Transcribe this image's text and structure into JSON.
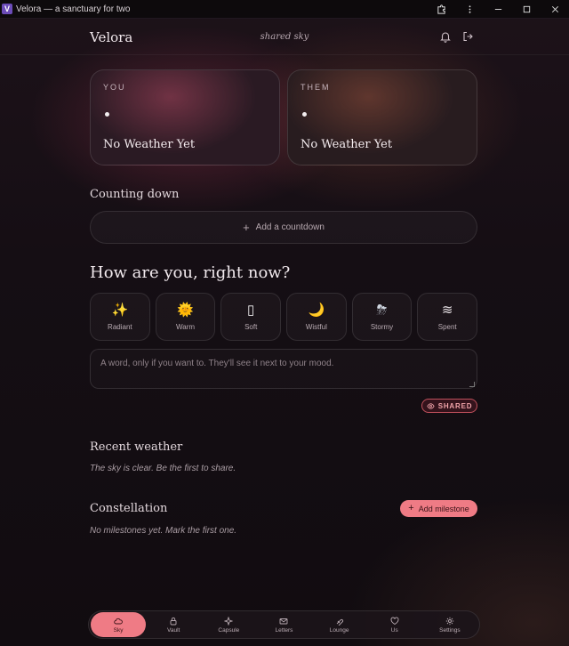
{
  "window": {
    "title": "Velora — a sanctuary for two",
    "app_icon_letter": "V"
  },
  "header": {
    "brand": "Velora",
    "subtitle": "shared sky"
  },
  "weather_cards": [
    {
      "label": "YOU",
      "status": "No Weather Yet"
    },
    {
      "label": "THEM",
      "status": "No Weather Yet"
    }
  ],
  "countdown": {
    "title": "Counting down",
    "add_label": "Add a countdown"
  },
  "mood": {
    "title": "How are you, right now?",
    "options": [
      {
        "emoji": "✨",
        "label": "Radiant"
      },
      {
        "emoji": "🌞",
        "label": "Warm"
      },
      {
        "emoji": "▯",
        "label": "Soft"
      },
      {
        "emoji": "🌙",
        "label": "Wistful"
      },
      {
        "emoji": "⛈",
        "label": "Stormy"
      },
      {
        "emoji": "≋",
        "label": "Spent"
      }
    ],
    "note_placeholder": "A word, only if you want to. They'll see it next to your mood.",
    "note_value": "",
    "visibility_label": "SHARED"
  },
  "recent_weather": {
    "title": "Recent weather",
    "empty_text": "The sky is clear. Be the first to share."
  },
  "constellation": {
    "title": "Constellation",
    "add_label": "Add milestone",
    "empty_text": "No milestones yet. Mark the first one."
  },
  "nav": {
    "items": [
      {
        "label": "Sky",
        "icon": "cloud-icon",
        "active": true
      },
      {
        "label": "Vault",
        "icon": "lock-icon",
        "active": false
      },
      {
        "label": "Capsule",
        "icon": "sparkle-icon",
        "active": false
      },
      {
        "label": "Letters",
        "icon": "envelope-icon",
        "active": false
      },
      {
        "label": "Lounge",
        "icon": "lounge-icon",
        "active": false
      },
      {
        "label": "Us",
        "icon": "heart-icon",
        "active": false
      },
      {
        "label": "Settings",
        "icon": "gear-icon",
        "active": false
      }
    ]
  },
  "colors": {
    "accent": "#ef7b85",
    "background": "#120c11",
    "shared_border": "#c0505c"
  }
}
